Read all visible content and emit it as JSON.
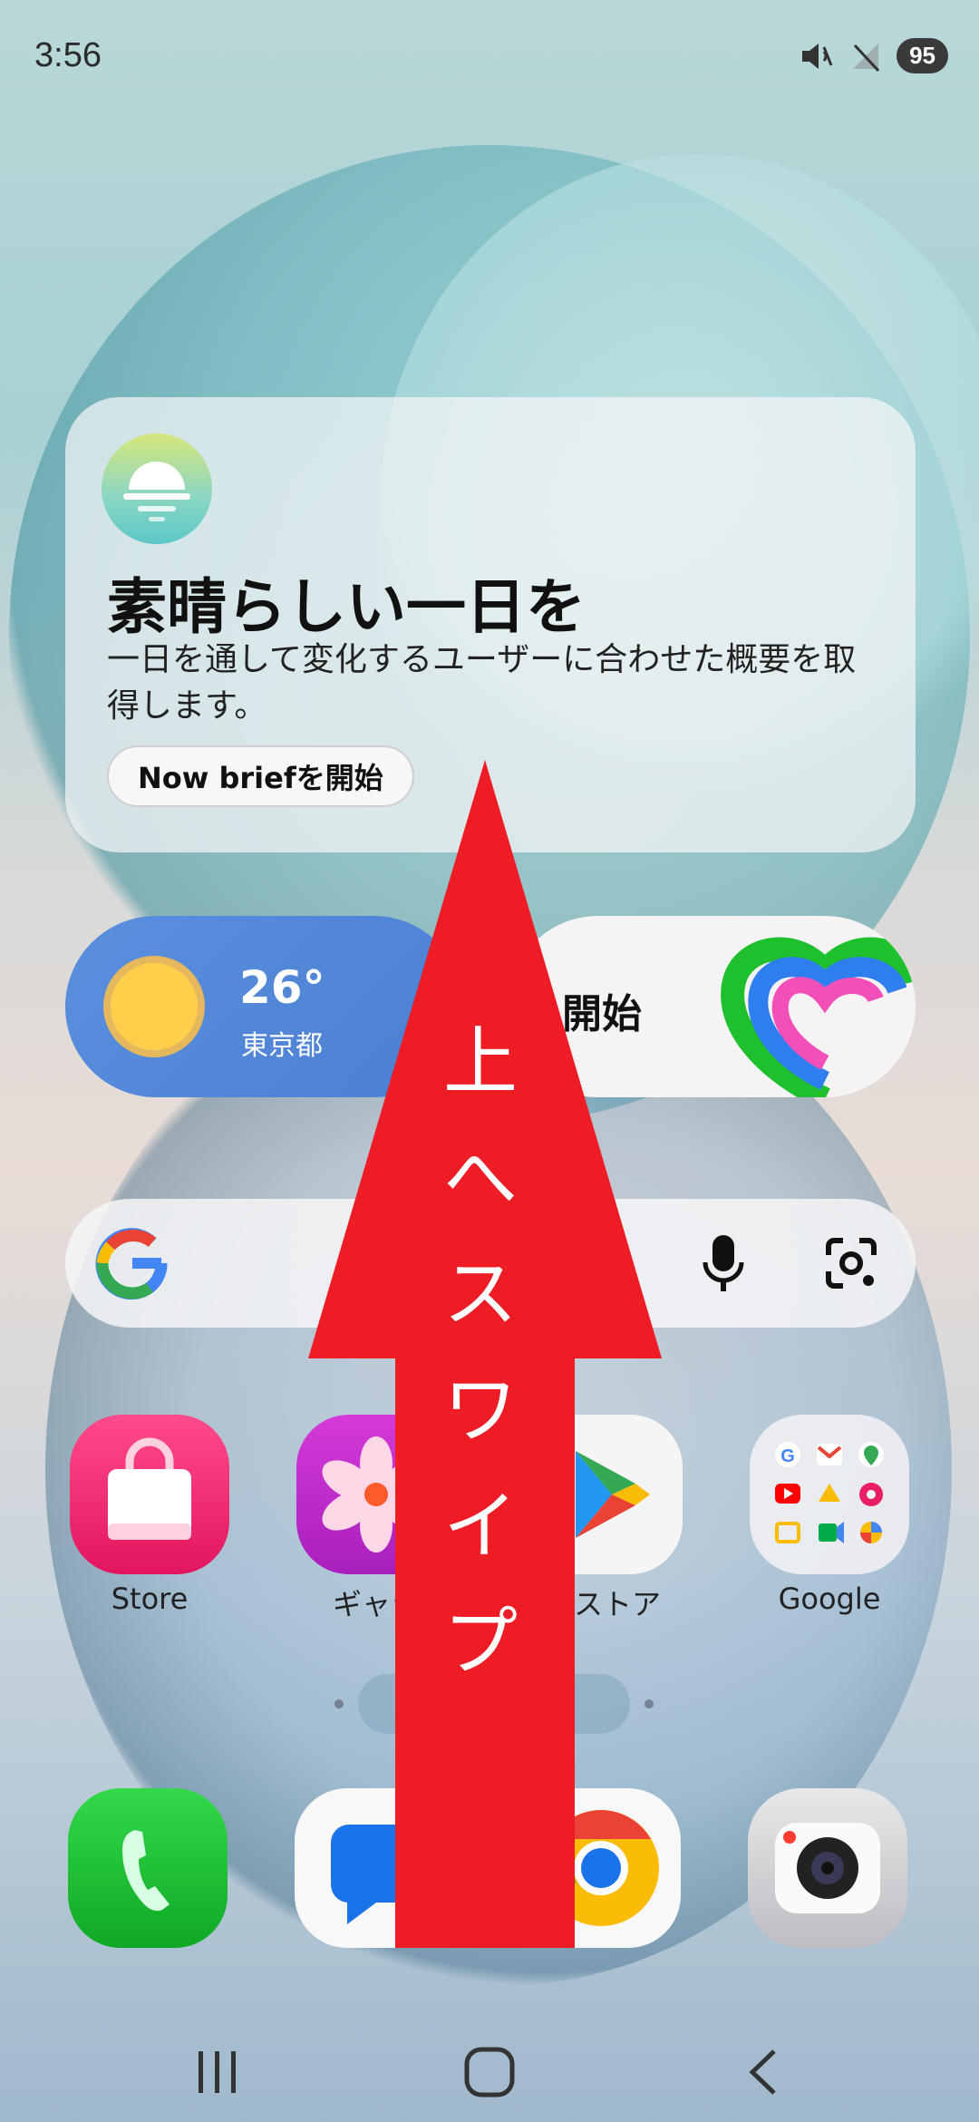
{
  "status_bar": {
    "time": "3:56",
    "battery": "95",
    "icons": [
      "mute-icon",
      "no-signal-icon"
    ]
  },
  "now_brief": {
    "title": "素晴らしい一日を",
    "description": "一日を通して変化するユーザーに合わせた概要を取得します。",
    "button_label": "Now briefを開始",
    "icon": "sunrise-icon"
  },
  "weather": {
    "temperature": "26°",
    "city": "東京都",
    "icon": "sun-icon"
  },
  "health_widget": {
    "label": "開始",
    "icon": "health-heart-icon"
  },
  "search_bar": {
    "logo": "google-g-logo",
    "mic_icon": "mic-icon",
    "lens_icon": "lens-icon"
  },
  "apps": [
    {
      "label": "Store",
      "icon": "store-bag-icon"
    },
    {
      "label": "ギャラ",
      "icon": "gallery-flower-icon"
    },
    {
      "label": "ッストア",
      "icon": "play-store-icon"
    },
    {
      "label": "Google",
      "icon": "google-folder-icon"
    }
  ],
  "dock": [
    {
      "icon": "phone-icon"
    },
    {
      "icon": "messages-icon"
    },
    {
      "icon": "chrome-icon"
    },
    {
      "icon": "camera-icon"
    }
  ],
  "overlay": {
    "text": [
      "上",
      "へ",
      "ス",
      "ワ",
      "イ",
      "プ"
    ],
    "color": "#ee1c25"
  },
  "nav": [
    "recents-icon",
    "home-icon",
    "back-icon"
  ],
  "colors": {
    "weather_bg": "#4a7fd3",
    "sun": "#ffcf4c",
    "store": "#e3155f",
    "gallery": "#a81fbd",
    "phone": "#0fa825"
  }
}
